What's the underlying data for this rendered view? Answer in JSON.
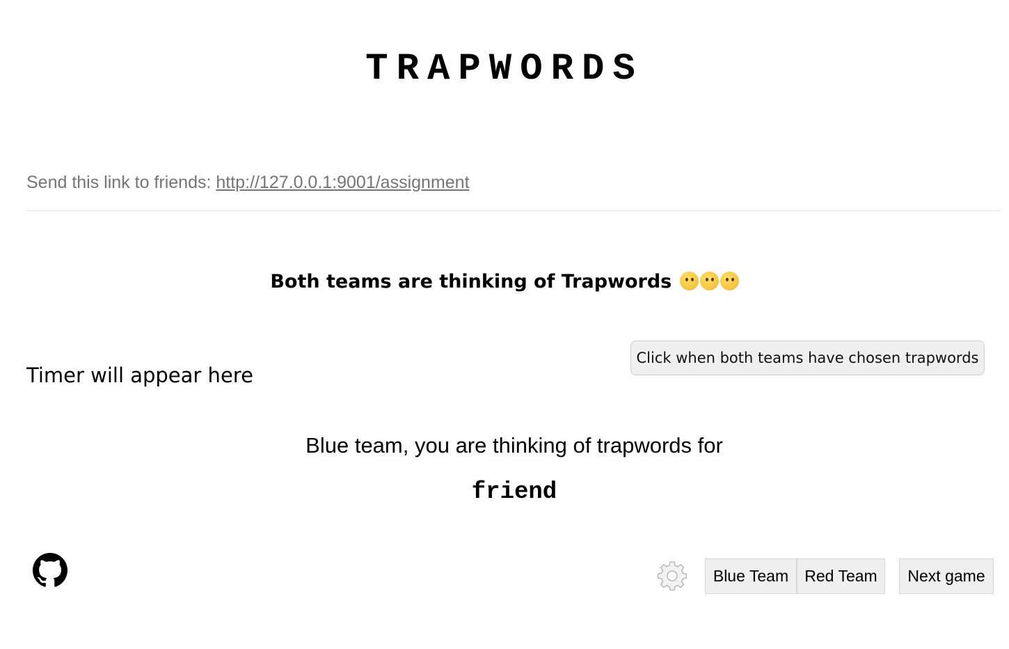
{
  "header": {
    "title": "TRAPWORDS"
  },
  "share": {
    "label": "Send this link to friends: ",
    "link_text": "http://127.0.0.1:9001/assignment"
  },
  "status": {
    "text": "Both teams are thinking of Trapwords ",
    "emoji_icons": [
      "thinking-face-icon",
      "thinking-face-icon",
      "thinking-face-icon"
    ]
  },
  "timer": {
    "placeholder": "Timer will appear here"
  },
  "actions": {
    "confirm_label": "Click when both teams have chosen trapwords"
  },
  "assignment": {
    "prompt": "Blue team, you are thinking of trapwords for",
    "word": "friend"
  },
  "footer": {
    "github_icon": "github-icon",
    "settings_icon": "gear-icon",
    "blue_team_label": "Blue Team",
    "red_team_label": "Red Team",
    "next_game_label": "Next game"
  },
  "colors": {
    "muted_text": "#757575",
    "button_bg": "#efefef",
    "divider": "#e3e3e3"
  }
}
